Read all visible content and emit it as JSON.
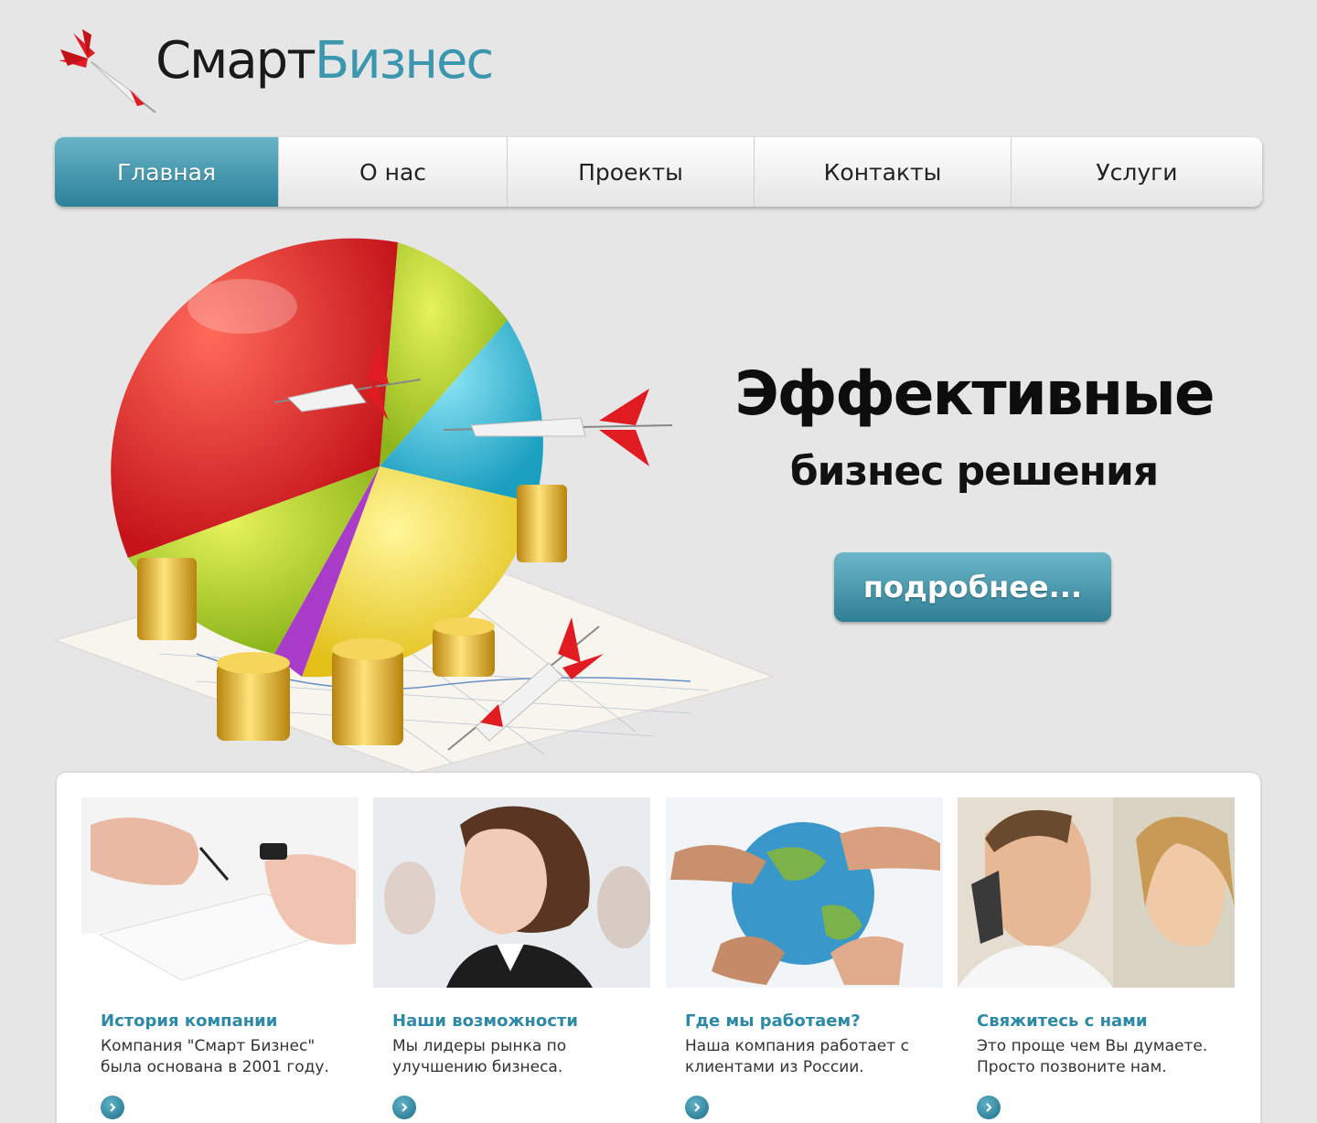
{
  "logo": {
    "word1": "Смарт",
    "word2": "Бизнес",
    "icon": "dart-icon"
  },
  "nav": {
    "items": [
      {
        "label": "Главная",
        "active": true
      },
      {
        "label": "О нас",
        "active": false
      },
      {
        "label": "Проекты",
        "active": false
      },
      {
        "label": "Контакты",
        "active": false
      },
      {
        "label": "Услуги",
        "active": false
      }
    ]
  },
  "hero": {
    "title": "Эффективные",
    "subtitle": "бизнес решения",
    "button": "подробнее..."
  },
  "cards": [
    {
      "title": "История компании",
      "text": "Компания \"Смарт Бизнес\"\nбыла основана в 2001 году.",
      "photo": "handshake-photo"
    },
    {
      "title": "Наши возможности",
      "text": "Мы лидеры рынка по\nулучшению бизнеса.",
      "photo": "businesswoman-photo"
    },
    {
      "title": "Где мы работаем?",
      "text": "Наша компания работает с\nклиентами из России.",
      "photo": "globe-hands-photo"
    },
    {
      "title": "Свяжитесь с нами",
      "text": "Это проще чем Вы думаете.\nПросто позвоните нам.",
      "photo": "phone-call-photo"
    }
  ],
  "colors": {
    "accent": "#2e8aa4",
    "background": "#e6e6e7",
    "title_dark": "#0d0d0d"
  }
}
